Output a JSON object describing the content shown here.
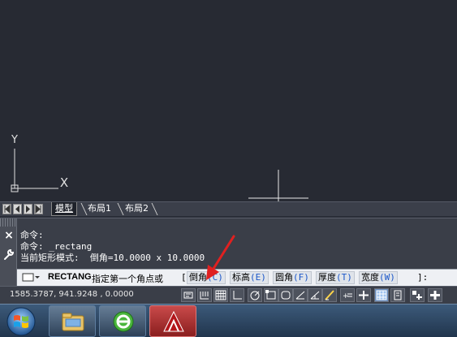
{
  "drawing": {
    "ucs_y_label": "Y",
    "ucs_x_label": "X"
  },
  "layout_tabs": {
    "items": [
      {
        "label": "模型",
        "active": true
      },
      {
        "label": "布局1",
        "active": false
      },
      {
        "label": "布局2",
        "active": false
      }
    ]
  },
  "command": {
    "history": [
      "命令:",
      "命令: _rectang",
      "当前矩形模式:  倒角=10.0000 x 10.0000"
    ],
    "current_command": "RECTANG",
    "prompt_text": "指定第一个角点或",
    "open_bracket": "[",
    "options": [
      {
        "label": "倒角",
        "key": "(C)"
      },
      {
        "label": "标高",
        "key": "(E)"
      },
      {
        "label": "圆角",
        "key": "(F)"
      },
      {
        "label": "厚度",
        "key": "(T)"
      },
      {
        "label": "宽度",
        "key": "(W)"
      }
    ],
    "close_bracket": "]:",
    "close_icon": "×"
  },
  "status": {
    "coordinates": "1585.3787, 941.9248 , 0.0000"
  },
  "colors": {
    "drawing_bg": "#272a33",
    "command_bg": "#3a3e48",
    "option_key": "#1a56c9",
    "annotation_arrow": "#e02020"
  },
  "icons": {
    "start": "windows-start-icon",
    "explorer": "file-explorer-icon",
    "ie": "internet-explorer-icon",
    "autocad": "autocad-icon"
  }
}
